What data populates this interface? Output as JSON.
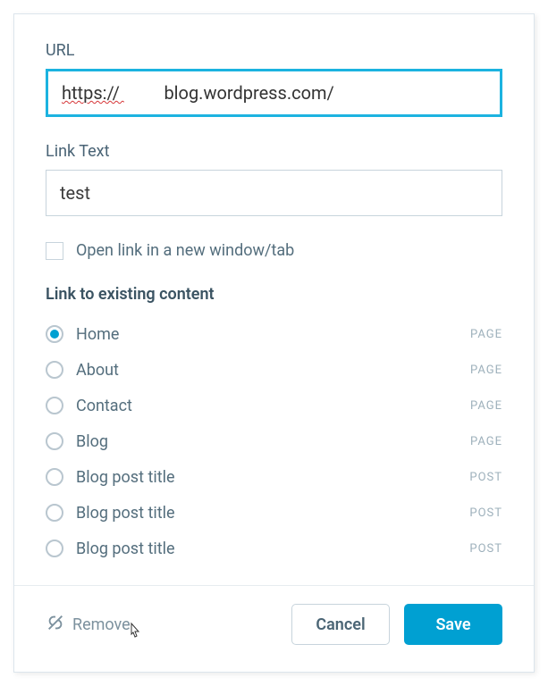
{
  "url": {
    "label": "URL",
    "prefix": "https:// ",
    "squiggle_gap": "         ",
    "domain": "blog.wordpress.com/"
  },
  "linktext": {
    "label": "Link Text",
    "value": "test"
  },
  "open_new": {
    "label": "Open link in a new window/tab",
    "checked": false
  },
  "existing": {
    "heading": "Link to existing content",
    "items": [
      {
        "title": "Home",
        "type": "PAGE",
        "selected": true
      },
      {
        "title": "About",
        "type": "PAGE",
        "selected": false
      },
      {
        "title": "Contact",
        "type": "PAGE",
        "selected": false
      },
      {
        "title": "Blog",
        "type": "PAGE",
        "selected": false
      },
      {
        "title": "Blog post title",
        "type": "POST",
        "selected": false
      },
      {
        "title": "Blog post title",
        "type": "POST",
        "selected": false
      },
      {
        "title": "Blog post title",
        "type": "POST",
        "selected": false
      }
    ]
  },
  "footer": {
    "remove": "Remove",
    "cancel": "Cancel",
    "save": "Save"
  }
}
